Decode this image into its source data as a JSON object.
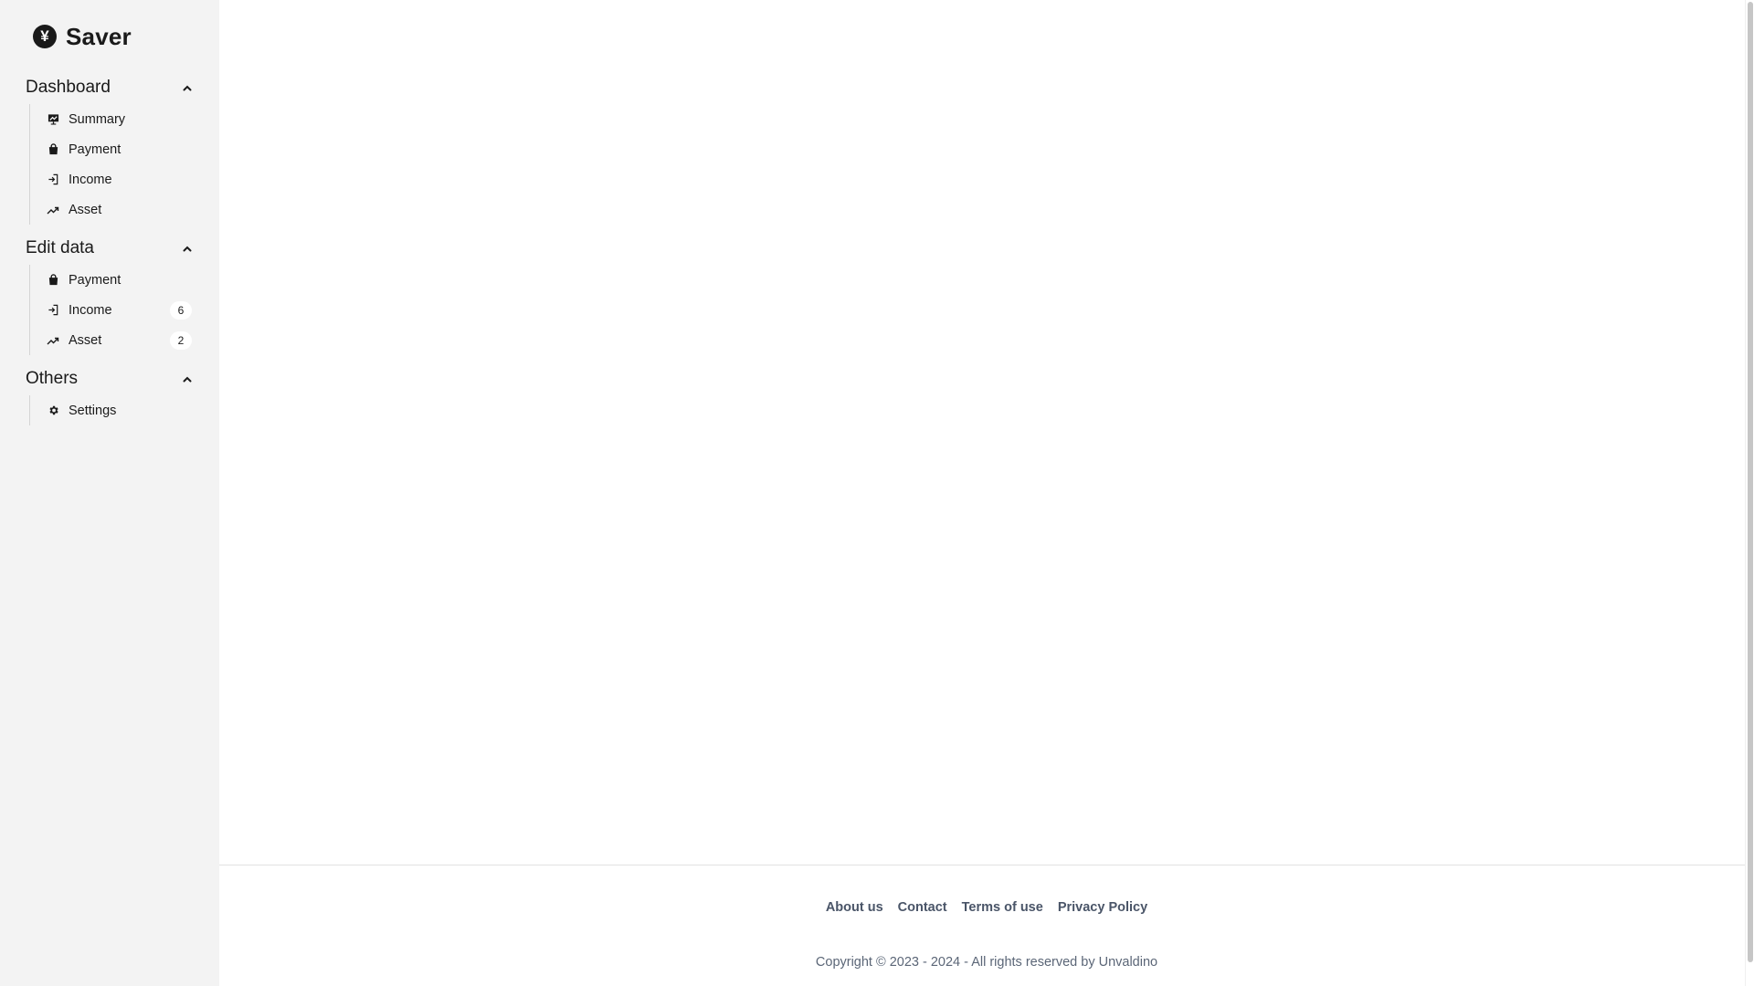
{
  "brand": {
    "name": "Saver",
    "icon": "yen-coin-icon"
  },
  "sidebar": {
    "sections": [
      {
        "title": "Dashboard",
        "items": [
          {
            "label": "Summary",
            "icon": "presentation-chart-icon"
          },
          {
            "label": "Payment",
            "icon": "shopping-bag-icon"
          },
          {
            "label": "Income",
            "icon": "login-arrow-icon"
          },
          {
            "label": "Asset",
            "icon": "trending-up-icon"
          }
        ]
      },
      {
        "title": "Edit data",
        "items": [
          {
            "label": "Payment",
            "icon": "shopping-bag-icon"
          },
          {
            "label": "Income",
            "icon": "login-arrow-icon",
            "badge": "6"
          },
          {
            "label": "Asset",
            "icon": "trending-up-icon",
            "badge": "2"
          }
        ]
      },
      {
        "title": "Others",
        "items": [
          {
            "label": "Settings",
            "icon": "gear-icon"
          }
        ]
      }
    ]
  },
  "footer": {
    "links": [
      "About us",
      "Contact",
      "Terms of use",
      "Privacy Policy"
    ],
    "copyright": "Copyright © 2023 - 2024 - All rights reserved by Unvaldino"
  }
}
